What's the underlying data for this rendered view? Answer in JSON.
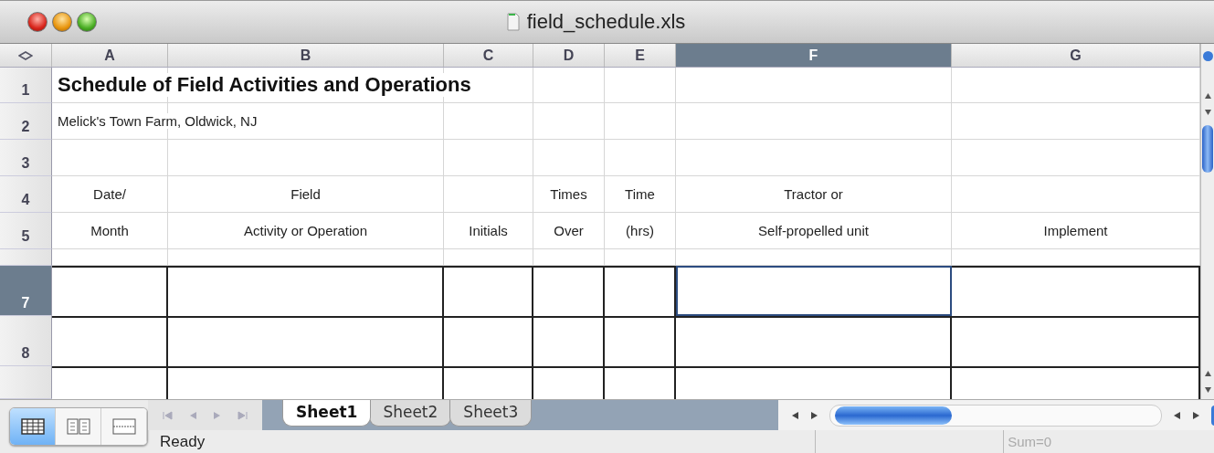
{
  "window": {
    "title": "field_schedule.xls"
  },
  "columns": [
    {
      "label": "A",
      "selected": false
    },
    {
      "label": "B",
      "selected": false
    },
    {
      "label": "C",
      "selected": false
    },
    {
      "label": "D",
      "selected": false
    },
    {
      "label": "E",
      "selected": false
    },
    {
      "label": "F",
      "selected": true
    },
    {
      "label": "G",
      "selected": false
    }
  ],
  "rows": [
    {
      "label": "1",
      "kind": "title",
      "selected": false,
      "cells": {
        "A": "Schedule of Field Activities and Operations"
      }
    },
    {
      "label": "2",
      "kind": "note",
      "selected": false,
      "cells": {
        "A": "Melick's Town Farm, Oldwick, NJ"
      }
    },
    {
      "label": "3",
      "kind": "blank",
      "selected": false
    },
    {
      "label": "4",
      "kind": "header",
      "selected": false,
      "cells": {
        "A": "Date/",
        "B": "Field",
        "D": "Times",
        "E": "Time",
        "F": "Tractor or"
      }
    },
    {
      "label": "5",
      "kind": "header",
      "selected": false,
      "cells": {
        "A": "Month",
        "B": "Activity or Operation",
        "C": "Initials",
        "D": "Over",
        "E": "(hrs)",
        "F": "Self-propelled unit",
        "G": "Implement"
      }
    },
    {
      "kind": "thin",
      "selected": false
    },
    {
      "label": "7",
      "kind": "entry",
      "selected": true
    },
    {
      "label": "8",
      "kind": "entry",
      "selected": false
    },
    {
      "kind": "cut",
      "selected": false
    }
  ],
  "view_modes": [
    {
      "kind": "normal",
      "selected": true
    },
    {
      "kind": "layout",
      "selected": false
    },
    {
      "kind": "page",
      "selected": false
    }
  ],
  "sheet_tabs": [
    {
      "label": "Sheet1",
      "selected": true
    },
    {
      "label": "Sheet2",
      "selected": false
    },
    {
      "label": "Sheet3",
      "selected": false
    }
  ],
  "status_bar": {
    "status": "Ready",
    "sum": "Sum=0"
  }
}
